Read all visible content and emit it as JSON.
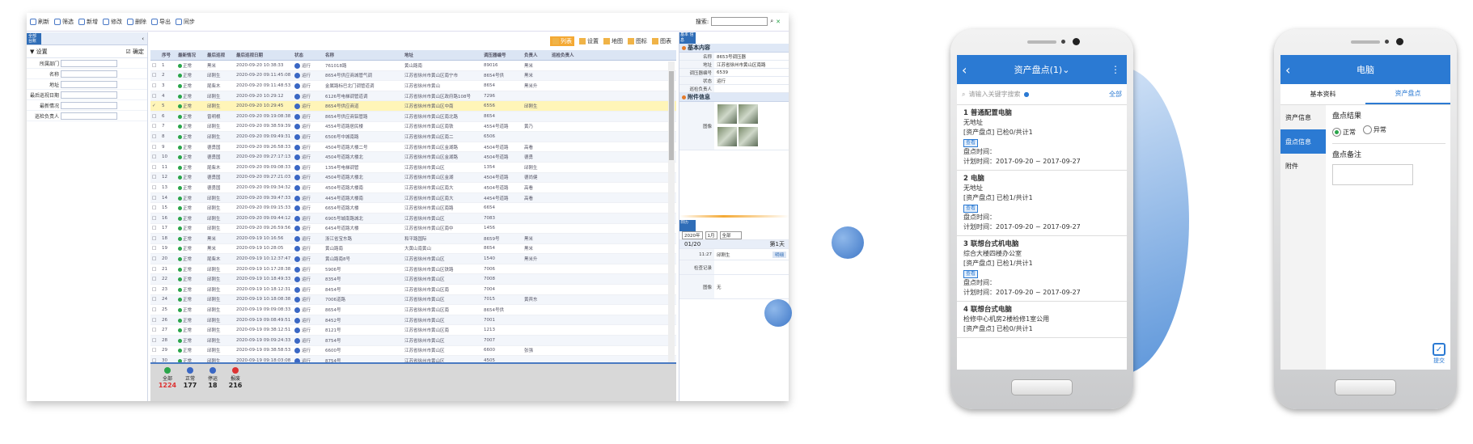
{
  "toolbar": {
    "items": [
      "刷新",
      "筛选",
      "新增",
      "修改",
      "删除",
      "导出",
      "同步"
    ],
    "search_label": "搜索:"
  },
  "left_panel": {
    "tag": "全部 台账",
    "title": "设置",
    "btn": "确定",
    "fields": [
      "所属部门",
      "名称",
      "地址",
      "最后巡视日期",
      "最新情况",
      "巡检负责人"
    ]
  },
  "grid": {
    "view_buttons": [
      "列表",
      "设置",
      "地图",
      "图标",
      "图表"
    ],
    "headers": [
      "",
      "序号",
      "最新情况",
      "最后巡视",
      "最后巡视日期",
      "状态",
      "名称",
      "地址",
      "调压器编号",
      "负责人",
      "巡检负责人"
    ],
    "rows": [
      [
        "1",
        "正常",
        "黑米",
        "2020-09-20 10:38:33",
        "运行",
        "761018路",
        "黄山路南",
        "89016",
        "黑米"
      ],
      [
        "2",
        "正常",
        "邱刚生",
        "2020-09-20 09:11:45:08",
        "运行",
        "8654号供应商城管气调",
        "江苏省徐州市黄山区南宁市",
        "8654号供",
        "黑米"
      ],
      [
        "3",
        "正常",
        "尾柴木",
        "2020-09-20 09:11:48:53",
        "运行",
        "金属路标巴北门调管道调",
        "江苏省徐州市黄山",
        "8654",
        "黑米升"
      ],
      [
        "4",
        "正常",
        "邱刚生",
        "2020-09-20 10:29:12",
        "运行",
        "6126号电梯调管道调",
        "江苏省徐州市黄山区政府路108号",
        "7296",
        ""
      ],
      [
        "5",
        "正常",
        "邱刚生",
        "2020-09-20 10:29:45",
        "运行",
        "8654号供应商道",
        "江苏省徐州市黄山区中南",
        "6556",
        "邱刚生"
      ],
      [
        "6",
        "正常",
        "曾明根",
        "2020-09-20 09:19:08:38",
        "运行",
        "8654号供应商铝管路",
        "江苏省徐州市黄山区南北路",
        "8654",
        ""
      ],
      [
        "7",
        "正常",
        "邱刚生",
        "2020-09-20 09:38:59:39",
        "运行",
        "4554号道路居民楼",
        "江苏省徐州市黄山区南铁",
        "4554号道路",
        "黄乃"
      ],
      [
        "8",
        "正常",
        "邱刚生",
        "2020-09-20 09:09:49:31",
        "运行",
        "6506号中城南路",
        "江苏省徐州市黄山区南二",
        "6506",
        ""
      ],
      [
        "9",
        "正常",
        "德勇国",
        "2020-09-20 09:26:58:33",
        "运行",
        "4504号道路大楼二号",
        "江苏省徐州市黄山区金湖路",
        "4504号道路",
        "高看"
      ],
      [
        "10",
        "正常",
        "德勇国",
        "2020-09-20 09:27:17:13",
        "运行",
        "4504号道路大楼北",
        "江苏省徐州市黄山区金湖路",
        "4504号道路",
        "德勇"
      ],
      [
        "11",
        "正常",
        "尾柴木",
        "2020-09-20 09:09:08:33",
        "运行",
        "1354号电梯调管",
        "江苏省徐州市黄山区",
        "1354",
        "邱刚生"
      ],
      [
        "12",
        "正常",
        "德勇国",
        "2020-09-20 09:27:21:03",
        "运行",
        "4504号道路大楼北",
        "江苏省徐州市黄山区金湖",
        "4504号道路",
        "德尚健"
      ],
      [
        "13",
        "正常",
        "德勇国",
        "2020-09-20 09:09:34:32",
        "运行",
        "4504号道路大楼南",
        "江苏省徐州市黄山区南大",
        "4504号道路",
        "高看"
      ],
      [
        "14",
        "正常",
        "邱刚生",
        "2020-09-20 09:39:47:33",
        "运行",
        "4454号道路大楼南",
        "江苏省徐州市黄山区南大",
        "4454号道路",
        "高看"
      ],
      [
        "15",
        "正常",
        "邱刚生",
        "2020-09-20 09:09:15:33",
        "运行",
        "6654号道路大楼",
        "江苏省徐州市黄山区南路",
        "6654",
        ""
      ],
      [
        "16",
        "正常",
        "邱刚生",
        "2020-09-20 09:09:44:12",
        "运行",
        "6905号城南路城北",
        "江苏省徐州市黄山区",
        "7083",
        ""
      ],
      [
        "17",
        "正常",
        "邱刚生",
        "2020-09-20 09:26:59:56",
        "运行",
        "6454号道路大楼",
        "江苏省徐州市黄山区南中",
        "1456",
        ""
      ],
      [
        "18",
        "正常",
        "黑米",
        "2020-09-19 10:16:56",
        "运行",
        "浙江省宝东路",
        "和平路国际",
        "8659号",
        "黑米"
      ],
      [
        "19",
        "正常",
        "黑米",
        "2020-09-19 10:28:05",
        "运行",
        "黄山路南",
        "大黄山南黄山",
        "8654",
        "黑米"
      ],
      [
        "20",
        "正常",
        "尾柴木",
        "2020-09-19 10:12:37:47",
        "运行",
        "黄山路南8号",
        "江苏省徐州市黄山区",
        "1540",
        "黑米升"
      ],
      [
        "21",
        "正常",
        "邱刚生",
        "2020-09-19 10:17:28:38",
        "运行",
        "5906号",
        "江苏省徐州市黄山区铁路",
        "7006",
        ""
      ],
      [
        "22",
        "正常",
        "邱刚生",
        "2020-09-19 10:18:49:33",
        "运行",
        "8354号",
        "江苏省徐州市黄山区",
        "7008",
        ""
      ],
      [
        "23",
        "正常",
        "邱刚生",
        "2020-09-19 10:18:12:31",
        "运行",
        "8454号",
        "江苏省徐州市黄山区南",
        "7004",
        ""
      ],
      [
        "24",
        "正常",
        "邱刚生",
        "2020-09-19 10:18:08:38",
        "运行",
        "7006道路",
        "江苏省徐州市黄山区",
        "7015",
        "黄宾东"
      ],
      [
        "25",
        "正常",
        "邱刚生",
        "2020-09-19 09:09:08:33",
        "运行",
        "8654号",
        "江苏省徐州市黄山区南",
        "8654号供",
        ""
      ],
      [
        "26",
        "正常",
        "邱刚生",
        "2020-09-19 09:08:49:51",
        "运行",
        "8452号",
        "江苏省徐州市黄山区",
        "7001",
        ""
      ],
      [
        "27",
        "正常",
        "邱刚生",
        "2020-09-19 09:38:12:51",
        "运行",
        "8121号",
        "江苏省徐州市黄山区南",
        "1213",
        ""
      ],
      [
        "28",
        "正常",
        "邱刚生",
        "2020-09-19 09:09:24:33",
        "运行",
        "8754号",
        "江苏省徐州市黄山区",
        "7007",
        ""
      ],
      [
        "29",
        "正常",
        "邱刚生",
        "2020-09-19 09:38:58:53",
        "运行",
        "6600号",
        "江苏省徐州市黄山区",
        "6600",
        "张强"
      ],
      [
        "30",
        "正常",
        "邱刚生",
        "2020-09-19 09:18:03:08",
        "运行",
        "8754号",
        "江苏省徐州市黄山区",
        "4505",
        ""
      ]
    ],
    "footer": [
      {
        "label": "全部",
        "count": "1224",
        "color": "#2aa54a"
      },
      {
        "label": "正常",
        "count": "177",
        "color": "#3a67c4"
      },
      {
        "label": "停运",
        "count": "18",
        "color": "#3a67c4"
      },
      {
        "label": "报废",
        "count": "216",
        "color": "#d33"
      }
    ]
  },
  "right_panel": {
    "tag": "基本 信息",
    "section1": "基本内容",
    "fields": [
      [
        "名称",
        "8653号调压器"
      ],
      [
        "地址",
        "江苏省徐州市黄山区南路"
      ],
      [
        "调压器编号",
        "6539"
      ],
      [
        "状态",
        "运行"
      ],
      [
        "巡检负责人",
        ""
      ]
    ],
    "section2": "附件信息",
    "image_label": "图像",
    "cal_tag": "日历",
    "year": "2020年",
    "month": "1月",
    "filter": "全部",
    "date": "01/20",
    "week": "第1天",
    "time": "11:27",
    "person": "邱刚生",
    "detail": "明细",
    "rec_label": "检查记录",
    "img_label": "图像",
    "img_val": "无"
  },
  "phone1": {
    "title": "资产盘点(1)",
    "search_placeholder": "请输入关键字搜索",
    "all": "全部",
    "items": [
      {
        "t": "1 普通配置电脑",
        "loc": "无地址",
        "status": "[资产盘点] 已检0/共计1",
        "badge": "查看",
        "tl": "盘点时间：",
        "plan": "计划时间：2017-09-20 ~ 2017-09-27"
      },
      {
        "t": "2 电脑",
        "loc": "无地址",
        "status": "[资产盘点] 已检1/共计1",
        "badge": "查看",
        "tl": "盘点时间：",
        "plan": "计划时间：2017-09-20 ~ 2017-09-27"
      },
      {
        "t": "3 联想台式机电脑",
        "loc": "综合大楼四楼办公室",
        "status": "[资产盘点] 已检1/共计1",
        "badge": "查看",
        "tl": "盘点时间：",
        "plan": "计划时间：2017-09-20 ~ 2017-09-27"
      },
      {
        "t": "4 联想台式电脑",
        "loc": "检修中心机房2楼检修1室公用",
        "status": "[资产盘点] 已检0/共计1",
        "badge": "",
        "tl": "",
        "plan": ""
      }
    ]
  },
  "phone2": {
    "title": "电脑",
    "tabs": [
      "基本资料",
      "资产盘点"
    ],
    "side": [
      "资产信息",
      "盘点信息",
      "附件"
    ],
    "result_label": "盘点结果",
    "normal": "正常",
    "abnormal": "异常",
    "remark_label": "盘点备注",
    "submit": "提交"
  }
}
